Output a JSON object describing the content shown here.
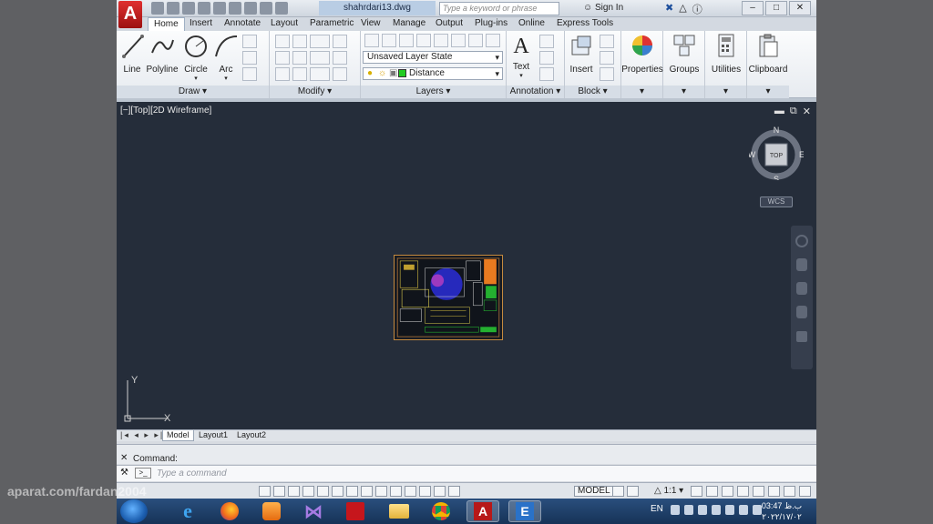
{
  "window": {
    "file_title": "shahrdari13.dwg",
    "search_placeholder": "Type a keyword or phrase",
    "signin_label": "Sign In",
    "min_btn": "–",
    "max_btn": "□",
    "close_btn": "✕"
  },
  "tabs": [
    "Home",
    "Insert",
    "Annotate",
    "Layout",
    "Parametric",
    "View",
    "Manage",
    "Output",
    "Plug-ins",
    "Online",
    "Express Tools"
  ],
  "ribbon": {
    "draw": {
      "label": "Draw",
      "line": "Line",
      "polyline": "Polyline",
      "circle": "Circle",
      "arc": "Arc"
    },
    "modify": {
      "label": "Modify"
    },
    "layers": {
      "label": "Layers",
      "layer_state": "Unsaved Layer State",
      "current_layer": "Distance",
      "layer_color": "#22cc22"
    },
    "annotation": {
      "label": "Annotation",
      "text": "Text"
    },
    "block": {
      "label": "Block",
      "insert": "Insert"
    },
    "properties": "Properties",
    "groups": "Groups",
    "utilities": "Utilities",
    "clipboard": "Clipboard"
  },
  "viewport": {
    "label": "[−][Top][2D Wireframe]",
    "viewcube": {
      "n": "N",
      "s": "S",
      "e": "E",
      "w": "W",
      "face": "TOP"
    },
    "wcs": "WCS",
    "ucs_x": "X",
    "ucs_y": "Y"
  },
  "layout_tabs": [
    "Model",
    "Layout1",
    "Layout2"
  ],
  "command": {
    "history": "Command:",
    "placeholder": "Type a command"
  },
  "status": {
    "model": "MODEL",
    "scale": "1:1"
  },
  "taskbar": {
    "lang": "EN",
    "time": "03:47 ب.ظ",
    "date": "٢٠٢٢/١٧/٠٢"
  },
  "watermark": "aparat.com/fardan2004"
}
